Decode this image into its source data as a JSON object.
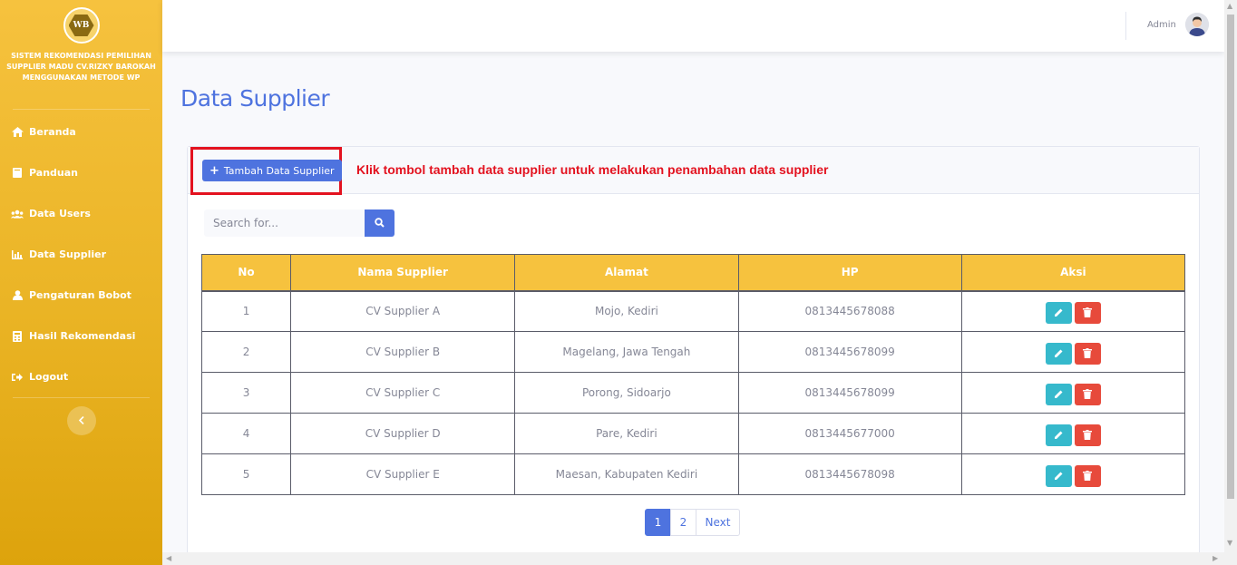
{
  "sidebar": {
    "logo_text": "WB",
    "brand": "SISTEM REKOMENDASI PEMILIHAN\nSUPPLIER MADU CV.RIZKY BAROKAH\nMENGGUNAKAN METODE WP",
    "items": [
      {
        "label": "Beranda",
        "icon": "home-icon"
      },
      {
        "label": "Panduan",
        "icon": "book-icon"
      },
      {
        "label": "Data Users",
        "icon": "users-icon"
      },
      {
        "label": "Data Supplier",
        "icon": "chart-bar-icon"
      },
      {
        "label": "Pengaturan Bobot",
        "icon": "user-icon"
      },
      {
        "label": "Hasil Rekomendasi",
        "icon": "calculator-icon"
      },
      {
        "label": "Logout",
        "icon": "logout-icon"
      }
    ]
  },
  "topbar": {
    "user_name": "Admin"
  },
  "page": {
    "title": "Data Supplier"
  },
  "card": {
    "add_button_label": "Tambah Data Supplier",
    "hint": "Klik tombol tambah data supplier untuk melakukan penambahan data supplier"
  },
  "search": {
    "placeholder": "Search for..."
  },
  "table": {
    "headers": [
      "No",
      "Nama Supplier",
      "Alamat",
      "HP",
      "Aksi"
    ],
    "rows": [
      {
        "no": "1",
        "nama": "CV Supplier A",
        "alamat": "Mojo, Kediri",
        "hp": "0813445678088"
      },
      {
        "no": "2",
        "nama": "CV Supplier B",
        "alamat": "Magelang, Jawa Tengah",
        "hp": "0813445678099"
      },
      {
        "no": "3",
        "nama": "CV Supplier C",
        "alamat": "Porong, Sidoarjo",
        "hp": "0813445678099"
      },
      {
        "no": "4",
        "nama": "CV Supplier D",
        "alamat": "Pare, Kediri",
        "hp": "0813445677000"
      },
      {
        "no": "5",
        "nama": "CV Supplier E",
        "alamat": "Maesan, Kabupaten Kediri",
        "hp": "0813445678098"
      }
    ]
  },
  "pagination": {
    "pages": [
      "1",
      "2"
    ],
    "next": "Next",
    "current": "1"
  },
  "colors": {
    "primary": "#4e73df",
    "warning": "#f6c23e",
    "info": "#36b9cc",
    "danger": "#e74a3b",
    "highlight": "#e3121f"
  }
}
